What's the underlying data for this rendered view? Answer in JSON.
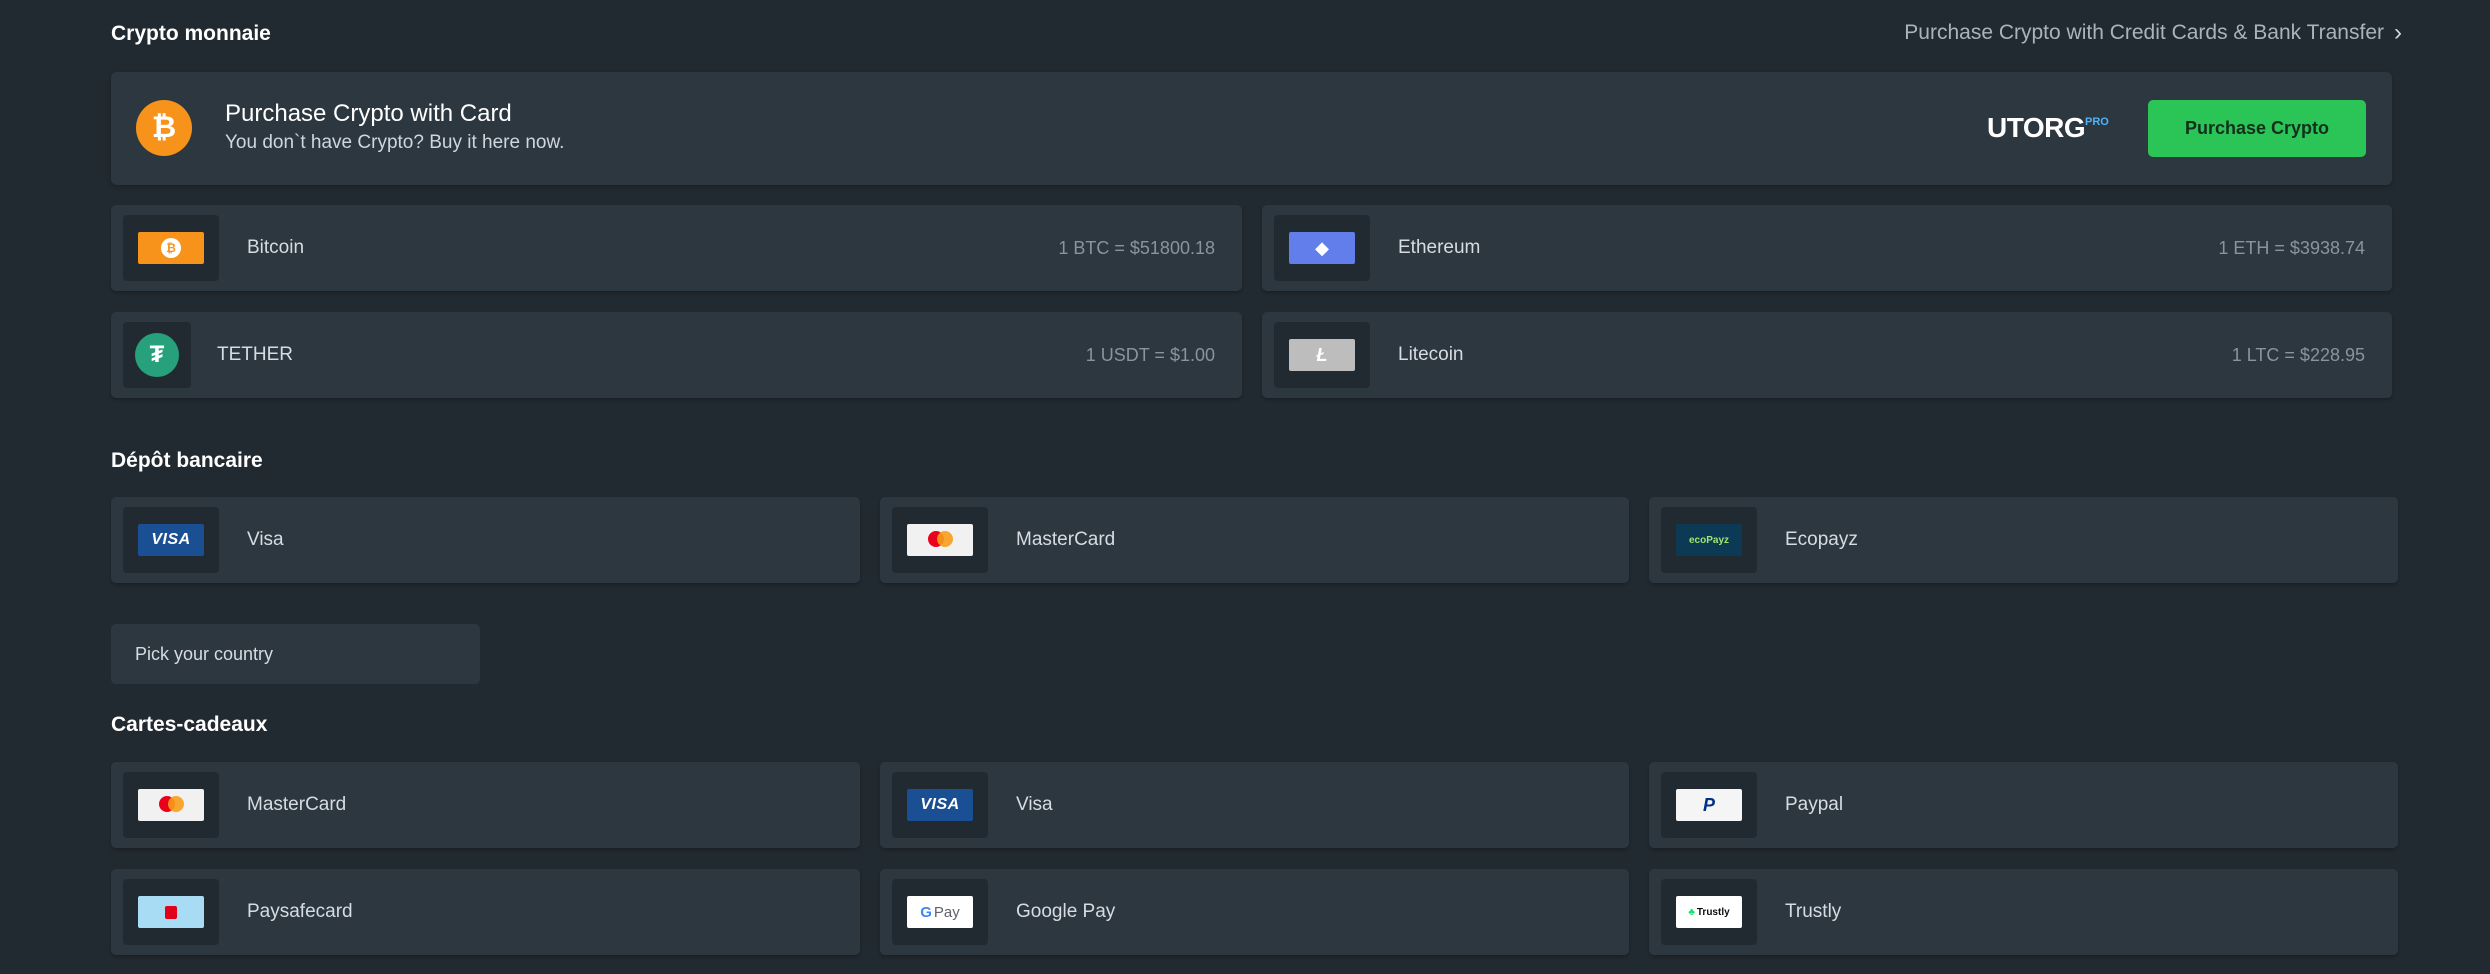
{
  "crypto": {
    "title": "Crypto monnaie",
    "top_link": "Purchase Crypto with Credit Cards & Bank Transfer",
    "banner": {
      "title": "Purchase Crypto with Card",
      "subtitle": "You don`t have Crypto? Buy it here now.",
      "brand": "UTORG",
      "brand_tag": "PRO",
      "button": "Purchase Crypto"
    },
    "coins": [
      {
        "name": "Bitcoin",
        "rate": "1 BTC = $51800.18",
        "icon": "bitcoin-icon"
      },
      {
        "name": "Ethereum",
        "rate": "1 ETH = $3938.74",
        "icon": "ethereum-icon"
      },
      {
        "name": "TETHER",
        "rate": "1 USDT = $1.00",
        "icon": "tether-icon"
      },
      {
        "name": "Litecoin",
        "rate": "1 LTC = $228.95",
        "icon": "litecoin-icon"
      }
    ]
  },
  "bank": {
    "title": "Dépôt bancaire",
    "methods": [
      {
        "name": "Visa",
        "icon": "visa-icon",
        "chip_text": "VISA"
      },
      {
        "name": "MasterCard",
        "icon": "mastercard-icon"
      },
      {
        "name": "Ecopayz",
        "icon": "ecopayz-icon",
        "chip_text": "ecoPayz"
      }
    ],
    "country_placeholder": "Pick your country"
  },
  "gift": {
    "title": "Cartes-cadeaux",
    "methods": [
      {
        "name": "MasterCard",
        "icon": "mastercard-icon"
      },
      {
        "name": "Visa",
        "icon": "visa-icon",
        "chip_text": "VISA"
      },
      {
        "name": "Paypal",
        "icon": "paypal-icon",
        "chip_text": "P"
      },
      {
        "name": "Paysafecard",
        "icon": "paysafecard-icon"
      },
      {
        "name": "Google Pay",
        "icon": "google-pay-icon",
        "chip_text": "Pay"
      },
      {
        "name": "Trustly",
        "icon": "trustly-icon",
        "chip_text": "Trustly"
      }
    ]
  },
  "colors": {
    "background": "#222a31",
    "card": "#2c3740",
    "accent_green": "#2bc457",
    "bitcoin": "#f7931a"
  }
}
